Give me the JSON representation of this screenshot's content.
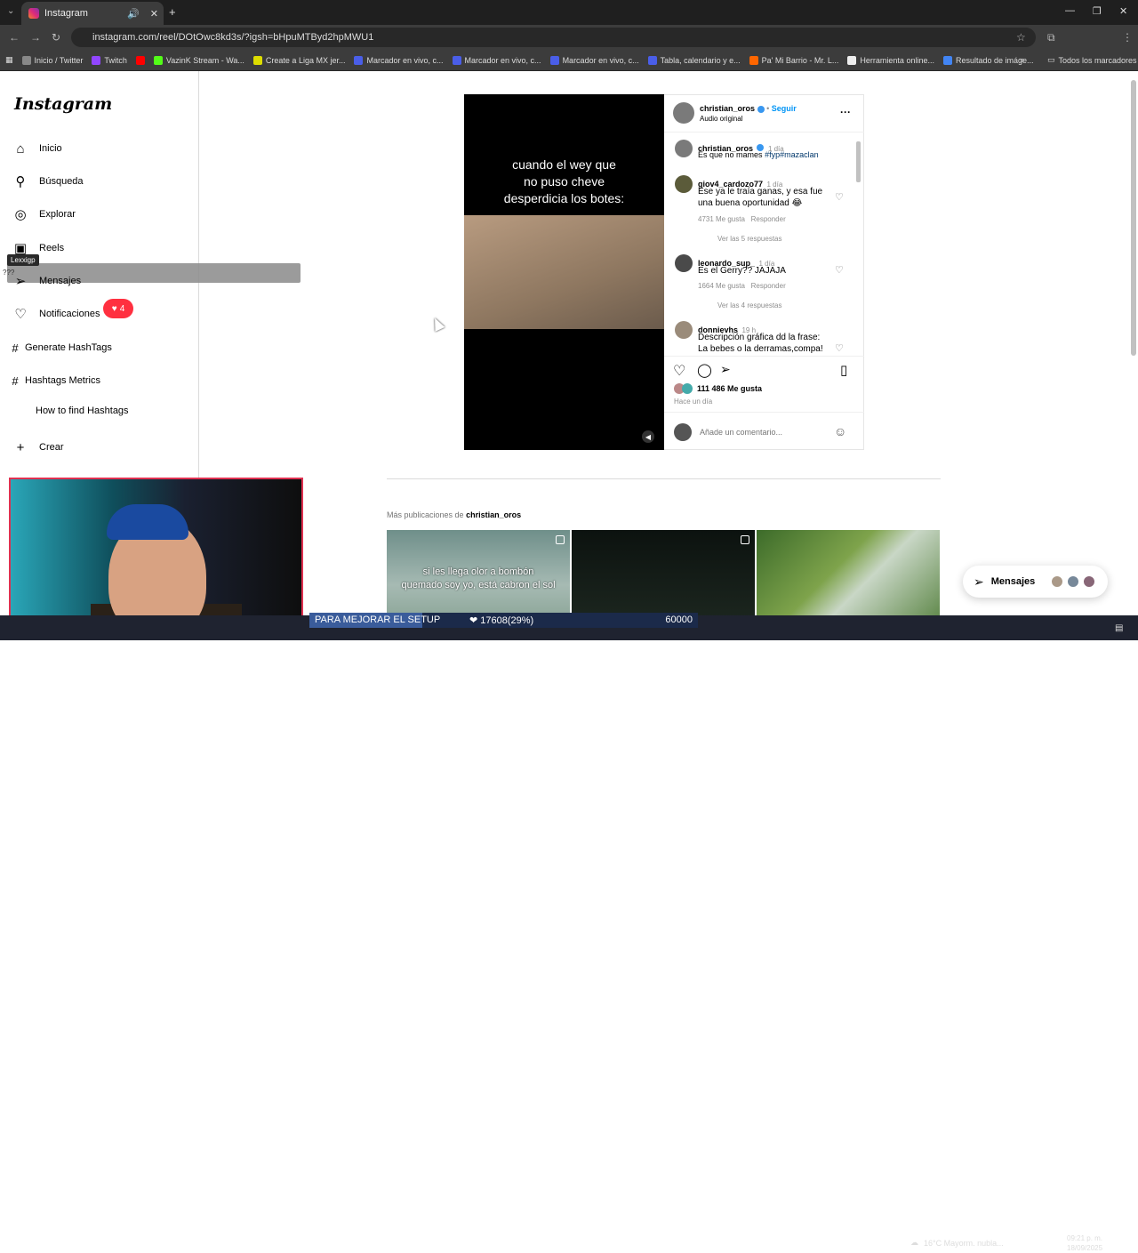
{
  "browser": {
    "tab_title": "Instagram",
    "url": "instagram.com/reel/DOtOwc8kd3s/?igsh=bHpuMTByd2hpMWU1",
    "bookmarks": [
      "Inicio / Twitter",
      "Twitch",
      "",
      "VazinK Stream - Wa...",
      "Create a Liga MX jer...",
      "Marcador en vivo, c...",
      "Marcador en vivo, c...",
      "Marcador en vivo, c...",
      "Tabla, calendario y e...",
      "Pa' Mi Barrio - Mr. L...",
      "Herramienta online...",
      "Resultado de imáge..."
    ],
    "all_bookmarks": "Todos los marcadores"
  },
  "sidebar": {
    "logo": "Instagram",
    "items": [
      {
        "label": "Inicio",
        "icon": "home-icon"
      },
      {
        "label": "Búsqueda",
        "icon": "search-icon"
      },
      {
        "label": "Explorar",
        "icon": "compass-icon"
      },
      {
        "label": "Reels",
        "icon": "reels-icon"
      },
      {
        "label": "Mensajes",
        "icon": "send-icon"
      },
      {
        "label": "Notificaciones",
        "icon": "heart-icon"
      },
      {
        "label": "Generate HashTags",
        "icon": "hashtag-icon"
      },
      {
        "label": "Hashtags Metrics",
        "icon": "hashtag-icon"
      },
      {
        "label": "How to find Hashtags",
        "icon": ""
      },
      {
        "label": "Crear",
        "icon": "plus-icon"
      }
    ],
    "notif_count": "4",
    "overlay_tag": "Lexxigp",
    "overlay_q": "???"
  },
  "reel": {
    "caption_overlay": "cuando el wey que\nno puso cheve\ndesperdicia los botes:",
    "header_user": "christian_oros",
    "follow": "Seguir",
    "audio": "Audio original",
    "comments": [
      {
        "user": "christian_oros",
        "time": "1 día",
        "text": "Es que no mames",
        "tags": "#fyp#mazaclan",
        "likes": "",
        "reply": "",
        "more": ""
      },
      {
        "user": "giov4_cardozo77",
        "time": "1 día",
        "text": "Ese ya le traía ganas, y esa fue una buena oportunidad 😂",
        "likes": "4731 Me gusta",
        "reply": "Responder",
        "more": "Ver las 5 respuestas"
      },
      {
        "user": "leonardo_sup_",
        "time": "1 día",
        "text": "Es el Gerry?? JAJAJA",
        "likes": "1664 Me gusta",
        "reply": "Responder",
        "more": "Ver las 4 respuestas"
      },
      {
        "user": "donnievhs",
        "time": "19 h",
        "text": "Descripción gráfica dd la frase: La bebes o la derramas,compa!",
        "likes": "",
        "reply": "",
        "more": ""
      }
    ],
    "likes": "111 486 Me gusta",
    "posted": "Hace un día",
    "comment_placeholder": "Añade un comentario..."
  },
  "more_posts": {
    "prefix": "Más publicaciones de",
    "user": "christian_oros",
    "thumb1_caption": "si les llega olor a bombón\nquemado soy yo, está cabron el sol"
  },
  "messages_pill": "Mensajes",
  "stream_goal": {
    "label": "PARA MEJORAR EL SETUP",
    "current": "17608(29%)",
    "target": "60000",
    "fraction": 0.29
  },
  "taskbar": {
    "weather": "16°C  Mayorm. nubla...",
    "time": "09:21 p. m.",
    "date": "18/09/2025"
  },
  "colors": {
    "accent_blue": "#0095f6",
    "notif_red": "#ff3040",
    "verified": "#3897f0"
  }
}
